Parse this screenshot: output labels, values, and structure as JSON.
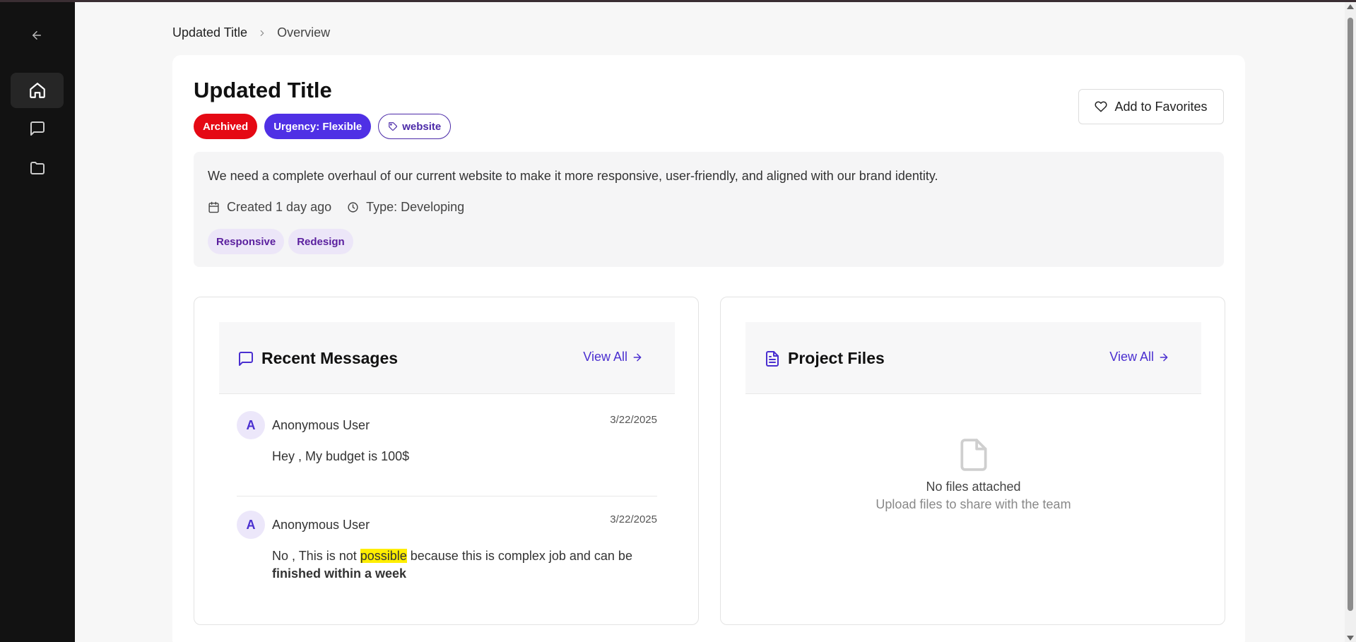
{
  "sidebar": {
    "back_icon": "arrow-left-icon",
    "items": [
      {
        "icon": "home-icon",
        "active": true
      },
      {
        "icon": "message-icon",
        "active": false
      },
      {
        "icon": "folder-icon",
        "active": false
      }
    ]
  },
  "breadcrumb": {
    "first": "Updated Title",
    "second": "Overview"
  },
  "project": {
    "title": "Updated Title",
    "badges": {
      "status": "Archived",
      "urgency": "Urgency: Flexible",
      "tag": "website"
    },
    "favorite_label": "Add to Favorites",
    "description": "We need a complete overhaul of our current website to make it more responsive, user-friendly, and aligned with our brand identity.",
    "created": "Created 1 day ago",
    "type": "Type: Developing",
    "skills": [
      "Responsive",
      "Redesign"
    ]
  },
  "messages_panel": {
    "title": "Recent Messages",
    "view_all": "View All",
    "messages": [
      {
        "avatar": "A",
        "user": "Anonymous User",
        "date": "3/22/2025",
        "body": "Hey , My budget is 100$"
      },
      {
        "avatar": "A",
        "user": "Anonymous User",
        "date": "3/22/2025",
        "body_pre": "No , This is not ",
        "body_highlight": "possible",
        "body_mid": " because this is complex job and can be ",
        "body_bold": "finished within a week"
      }
    ]
  },
  "files_panel": {
    "title": "Project Files",
    "view_all": "View All",
    "empty_title": "No files attached",
    "empty_subtitle": "Upload files to share with the team"
  },
  "colors": {
    "accent": "#4a2fd0",
    "archived": "#e50914",
    "urgency": "#4f30e5",
    "sidebar": "#121212",
    "highlight": "#ffee00"
  }
}
